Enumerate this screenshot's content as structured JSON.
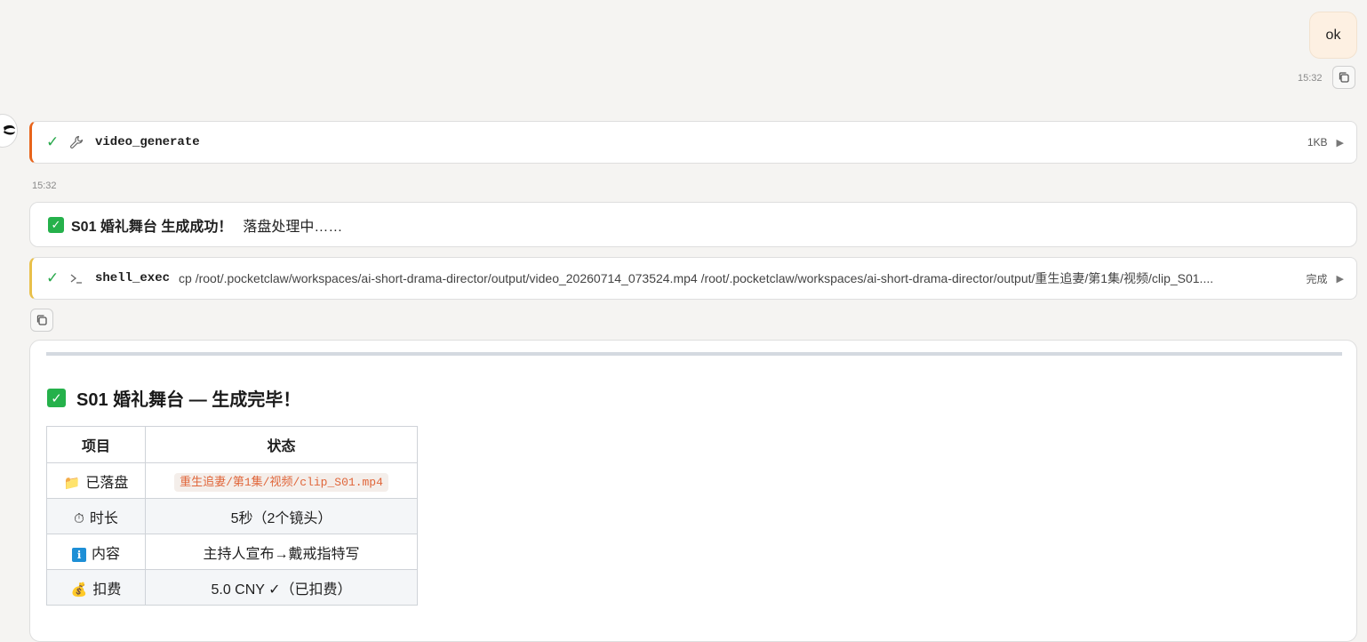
{
  "user_message": {
    "text": "ok",
    "time": "15:32"
  },
  "tool_calls": [
    {
      "name": "video_generate",
      "args": "",
      "meta": "1KB"
    },
    {
      "name": "shell_exec",
      "args": "cp /root/.pocketclaw/workspaces/ai-short-drama-director/output/video_20260714_073524.mp4 /root/.pocketclaw/workspaces/ai-short-drama-director/output/重生追妻/第1集/视频/clip_S01....",
      "meta": "完成"
    }
  ],
  "bot_time": "15:32",
  "status": {
    "bold": "S01 婚礼舞台 生成成功！",
    "rest": "落盘处理中……"
  },
  "answer": {
    "title": "S01 婚礼舞台 — 生成完毕！",
    "table": {
      "headers": [
        "项目",
        "状态"
      ],
      "rows": [
        {
          "icon": "📁",
          "icon_name": "folder-icon",
          "label": "已落盘",
          "value": "重生追妻/第1集/视频/clip_S01.mp4"
        },
        {
          "icon": "⏱",
          "icon_name": "stopwatch-icon",
          "label": "时长",
          "value": "5秒（2个镜头）"
        },
        {
          "icon": "ℹ",
          "icon_name": "info-icon",
          "label": "内容",
          "value": "主持人宣布→戴戒指特写"
        },
        {
          "icon": "💰",
          "icon_name": "money-bag-icon",
          "label": "扣费",
          "value": "5.0 CNY ✓（已扣费）"
        }
      ]
    }
  },
  "colors": {
    "accent_orange": "#e8641b",
    "accent_yellow": "#e9c04a",
    "success_green": "#25b14b"
  }
}
